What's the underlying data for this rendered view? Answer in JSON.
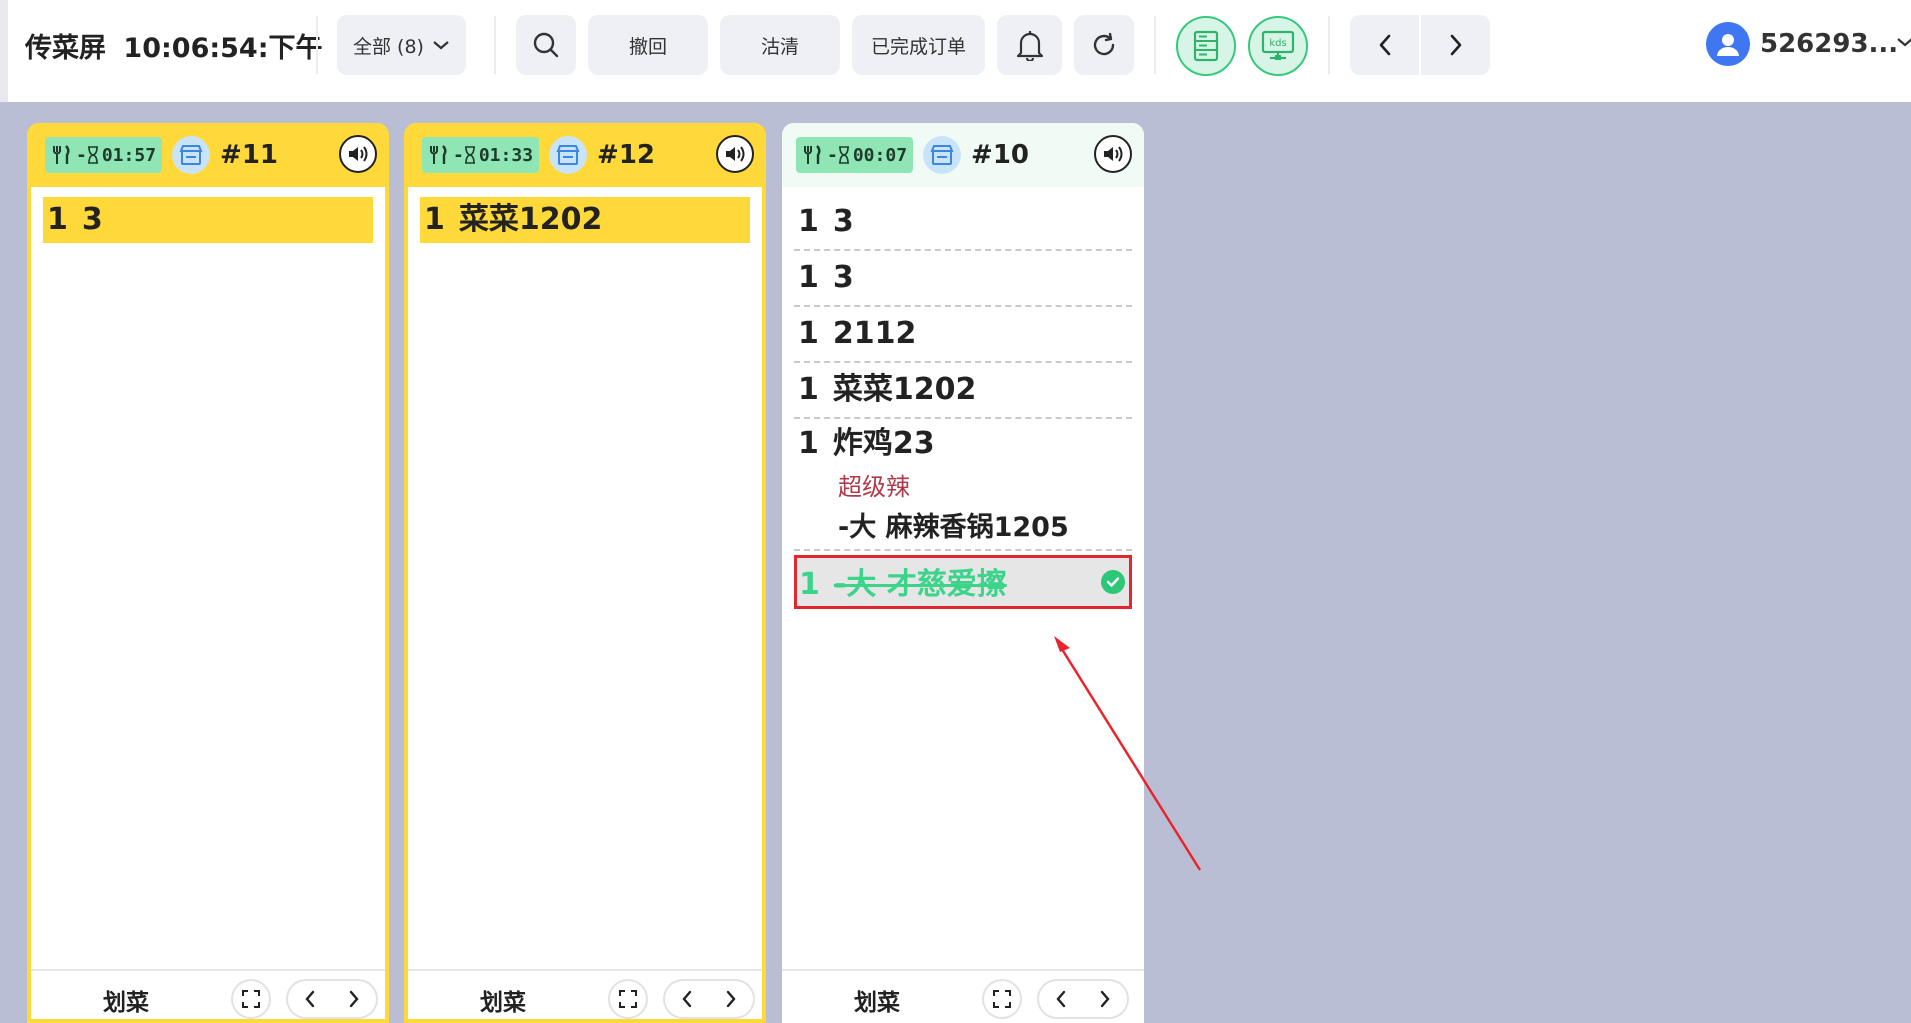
{
  "header": {
    "title": "传菜屏",
    "clock": "10:06:54:下午",
    "filter_label": "全部 (8)",
    "undo_label": "撤回",
    "clear_label": "沽清",
    "completed_orders_label": "已完成订单",
    "kds_label": "kds",
    "user_name": "526293..."
  },
  "orders": [
    {
      "timer": "01:57",
      "order_no": "#11",
      "items": [
        {
          "qty": "1",
          "name": "3"
        }
      ],
      "footer": {
        "label": "划菜"
      }
    },
    {
      "timer": "01:33",
      "order_no": "#12",
      "items": [
        {
          "qty": "1",
          "name": "菜菜1202"
        }
      ],
      "footer": {
        "label": "划菜"
      }
    },
    {
      "timer": "00:07",
      "order_no": "#10",
      "items": [
        {
          "qty": "1",
          "name": "3"
        },
        {
          "qty": "1",
          "name": "3"
        },
        {
          "qty": "1",
          "name": "2112"
        },
        {
          "qty": "1",
          "name": "菜菜1202"
        },
        {
          "qty": "1",
          "name": "炸鸡23",
          "modifier": "超级辣",
          "sub_item": "-大 麻辣香锅1205"
        },
        {
          "qty": "1",
          "name": "-大 才慈爱擦",
          "status": "done"
        }
      ],
      "footer": {
        "label": "划菜"
      }
    }
  ],
  "colors": {
    "yellow": "#ffd93a",
    "green": "#36c97b",
    "background": "#b9bed4",
    "highlight_red": "#e0262e",
    "modifier_red": "#b03a4b"
  }
}
